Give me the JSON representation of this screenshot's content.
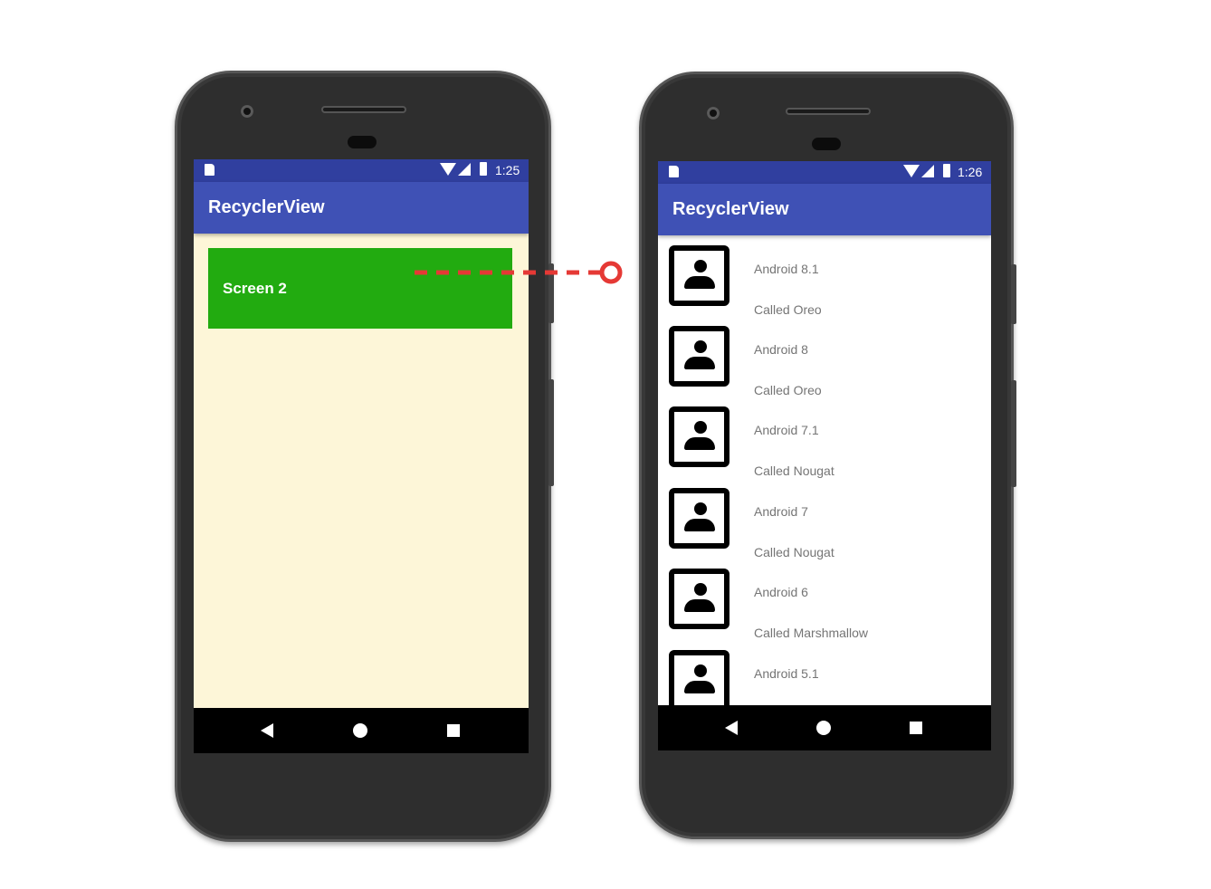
{
  "left_phone": {
    "status_time": "1:25",
    "app_title": "RecyclerView",
    "card_label": "Screen 2"
  },
  "right_phone": {
    "status_time": "1:26",
    "app_title": "RecyclerView",
    "items": [
      {
        "title": "Android 8.1",
        "subtitle": "Called Oreo"
      },
      {
        "title": "Android 8",
        "subtitle": "Called Oreo"
      },
      {
        "title": "Android 7.1",
        "subtitle": "Called Nougat"
      },
      {
        "title": "Android 7",
        "subtitle": "Called Nougat"
      },
      {
        "title": "Android 6",
        "subtitle": "Called Marshmallow"
      },
      {
        "title": "Android 5.1",
        "subtitle": ""
      }
    ]
  },
  "colors": {
    "status_bar": "#303f9f",
    "app_bar": "#3f51b5",
    "card": "#22ab10",
    "left_background": "#fdf6d8",
    "connector": "#e53935"
  },
  "icons": [
    "sd-card-icon",
    "wifi-icon",
    "signal-icon",
    "battery-icon",
    "back-icon",
    "home-icon",
    "recents-icon",
    "person-icon"
  ]
}
